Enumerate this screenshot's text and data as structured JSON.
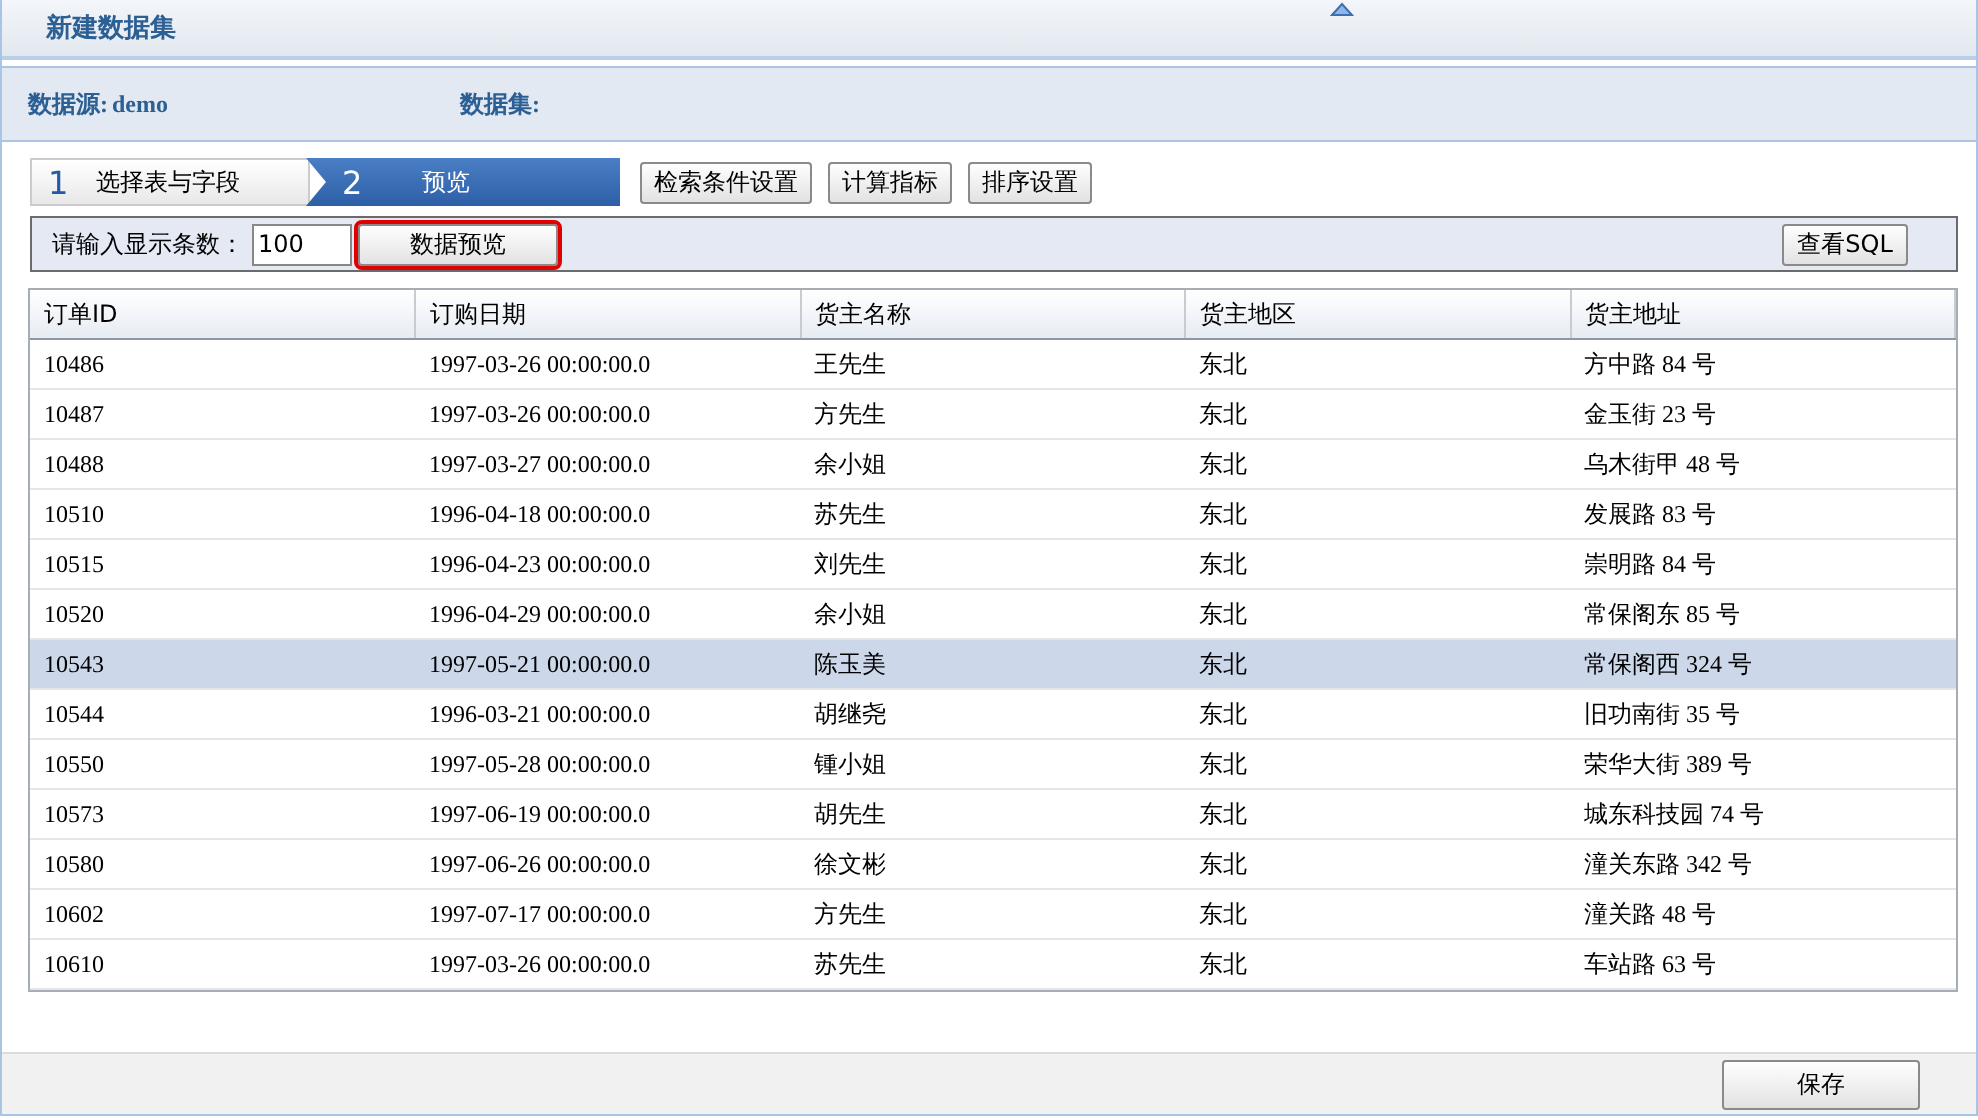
{
  "window": {
    "title": "新建数据集"
  },
  "info": {
    "source_label": "数据源:",
    "source_value": "demo",
    "dataset_label": "数据集:"
  },
  "steps": [
    {
      "number": "1",
      "label": "选择表与字段",
      "selected": false
    },
    {
      "number": "2",
      "label": "预览",
      "selected": true
    }
  ],
  "step_buttons": [
    "检索条件设置",
    "计算指标",
    "排序设置"
  ],
  "toolbar": {
    "count_label": "请输入显示条数：",
    "count_value": "100",
    "preview_button": {
      "label": "数据预览",
      "highlighted": true
    },
    "sql_button": "查看SQL"
  },
  "table": {
    "columns": [
      "订单ID",
      "订购日期",
      "货主名称",
      "货主地区",
      "货主地址"
    ],
    "rows": [
      {
        "cells": [
          "10486",
          "1997-03-26 00:00:00.0",
          "王先生",
          "东北",
          "方中路 84 号"
        ],
        "selected": false
      },
      {
        "cells": [
          "10487",
          "1997-03-26 00:00:00.0",
          "方先生",
          "东北",
          "金玉街 23 号"
        ],
        "selected": false
      },
      {
        "cells": [
          "10488",
          "1997-03-27 00:00:00.0",
          "余小姐",
          "东北",
          "乌木街甲 48 号"
        ],
        "selected": false
      },
      {
        "cells": [
          "10510",
          "1996-04-18 00:00:00.0",
          "苏先生",
          "东北",
          "发展路 83 号"
        ],
        "selected": false
      },
      {
        "cells": [
          "10515",
          "1996-04-23 00:00:00.0",
          "刘先生",
          "东北",
          "崇明路 84 号"
        ],
        "selected": false
      },
      {
        "cells": [
          "10520",
          "1996-04-29 00:00:00.0",
          "余小姐",
          "东北",
          "常保阁东 85 号"
        ],
        "selected": false
      },
      {
        "cells": [
          "10543",
          "1997-05-21 00:00:00.0",
          "陈玉美",
          "东北",
          "常保阁西 324 号"
        ],
        "selected": true
      },
      {
        "cells": [
          "10544",
          "1996-03-21 00:00:00.0",
          "胡继尧",
          "东北",
          "旧功南街 35 号"
        ],
        "selected": false
      },
      {
        "cells": [
          "10550",
          "1997-05-28 00:00:00.0",
          "锺小姐",
          "东北",
          "荣华大街 389 号"
        ],
        "selected": false
      },
      {
        "cells": [
          "10573",
          "1997-06-19 00:00:00.0",
          "胡先生",
          "东北",
          "城东科技园 74 号"
        ],
        "selected": false
      },
      {
        "cells": [
          "10580",
          "1997-06-26 00:00:00.0",
          "徐文彬",
          "东北",
          "潼关东路 342 号"
        ],
        "selected": false
      },
      {
        "cells": [
          "10602",
          "1997-07-17 00:00:00.0",
          "方先生",
          "东北",
          "潼关路 48 号"
        ],
        "selected": false
      },
      {
        "cells": [
          "10610",
          "1997-03-26 00:00:00.0",
          "苏先生",
          "东北",
          "车站路 63 号"
        ],
        "selected": false
      }
    ]
  },
  "footer": {
    "save_button": "保存"
  }
}
